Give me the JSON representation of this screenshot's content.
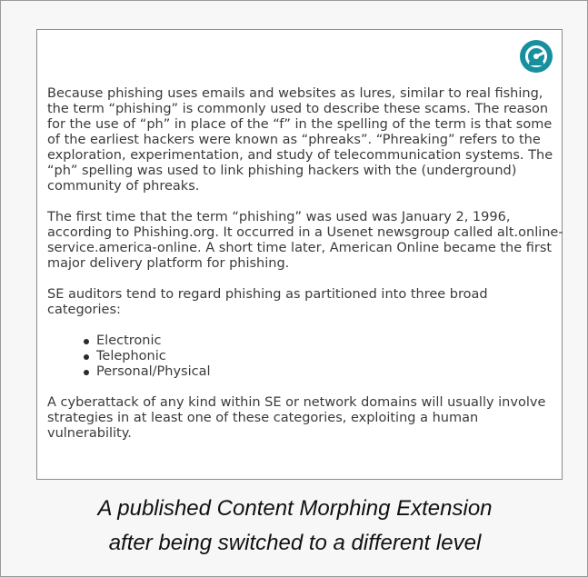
{
  "extension": {
    "icon": "gauge-icon",
    "color": "#16909e"
  },
  "article": {
    "paragraph_1": "Because phishing uses emails and websites as lures, similar to real fishing, the term “phishing” is commonly used to describe these scams. The reason for the use of “ph” in place of the “f” in the spelling of the term is that some of the earliest hackers were known as “phreaks”. “Phreaking” refers to the exploration, experimentation, and study of telecommunication systems. The “ph” spelling was used to link phishing hackers with the (underground) community of phreaks.",
    "paragraph_2": "The first time that the term “phishing” was used was January 2, 1996, according to Phishing.org. It occurred in a Usenet newsgroup called alt.online-service.america-online. A short time later, American Online became the first major delivery platform for phishing.",
    "paragraph_3": "SE auditors tend to regard phishing as partitioned into three broad categories:",
    "categories": [
      "Electronic",
      "Telephonic",
      "Personal/Physical"
    ],
    "paragraph_4": "A cyberattack of any kind within SE or network domains will usually involve strategies in at least one of these categories, exploiting a human vulnerability."
  },
  "caption": {
    "line_1": "A published Content Morphing Extension",
    "line_2": "after being switched to a different level"
  }
}
